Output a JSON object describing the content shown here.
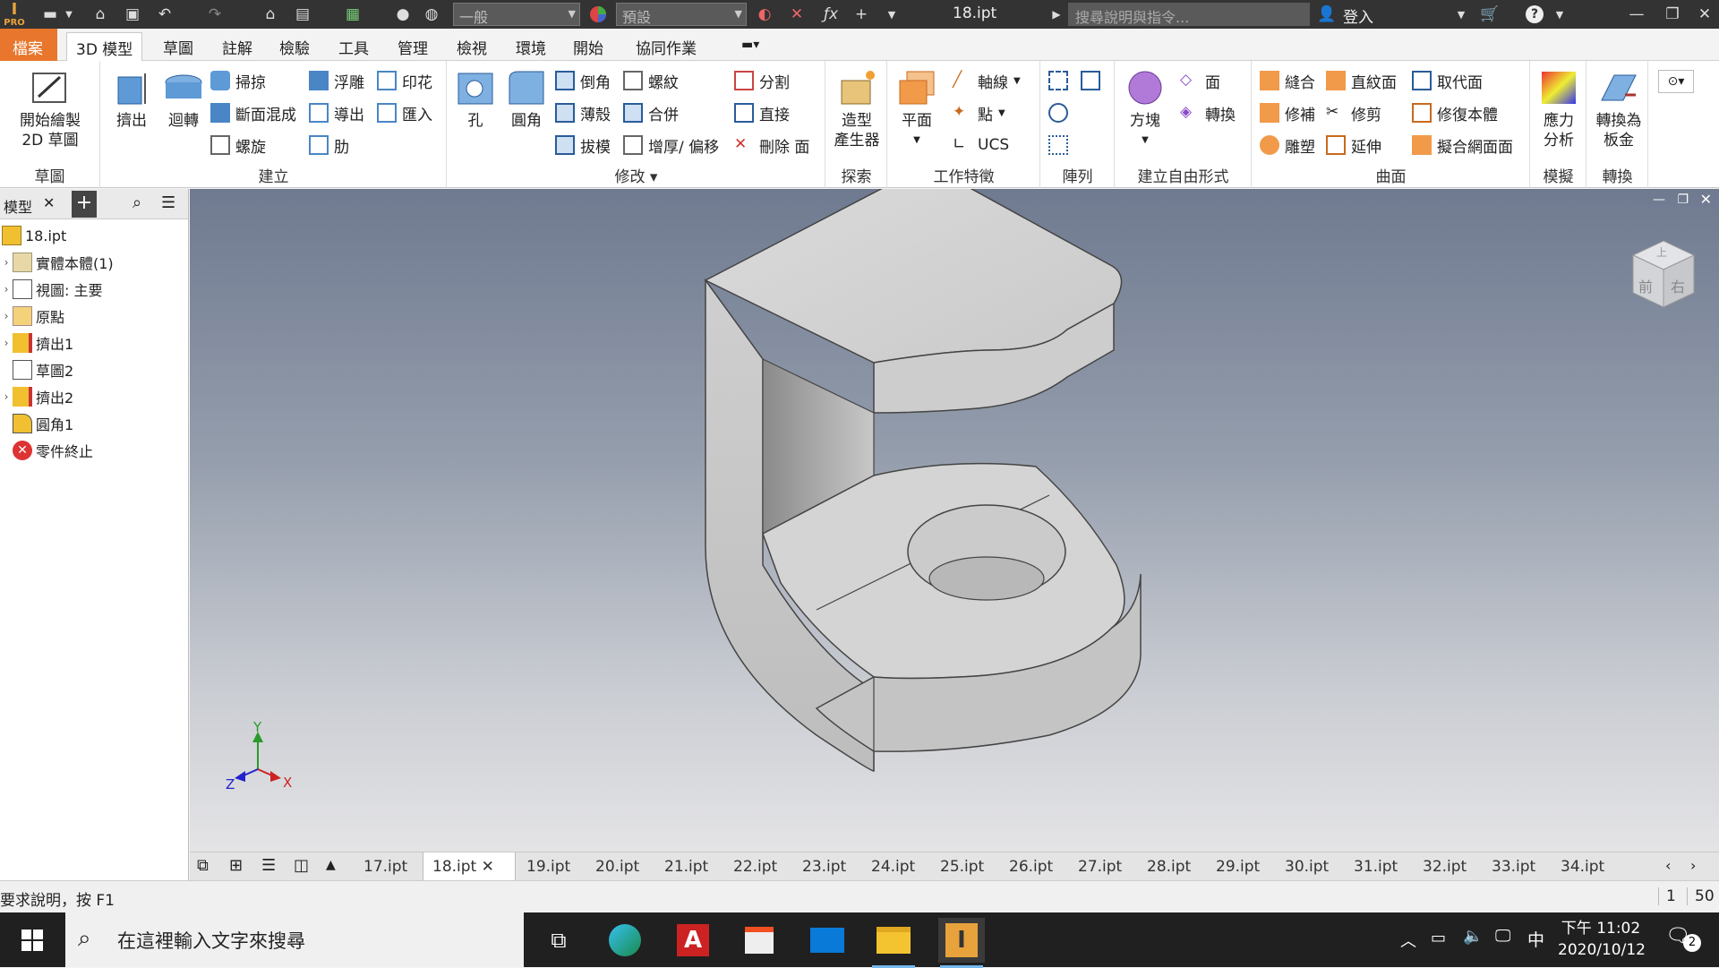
{
  "titlebar": {
    "app_logo": "PRO",
    "style_combo": "一般",
    "appearance_combo": "預設",
    "doc_title": "18.ipt",
    "search_placeholder": "搜尋說明與指令...",
    "sign_in": "登入",
    "icons": [
      "new-icon",
      "open-icon",
      "save-icon",
      "undo-icon",
      "redo-icon",
      "home-icon",
      "project-icon",
      "select-icon",
      "color-icon",
      "clear-appearance-icon",
      "fx-icon",
      "plus-icon",
      "cart-icon",
      "help-icon",
      "minimize-icon",
      "restore-icon",
      "close-icon"
    ]
  },
  "ribbon_tabs": [
    "檔案",
    "3D 模型",
    "草圖",
    "註解",
    "檢驗",
    "工具",
    "管理",
    "檢視",
    "環境",
    "開始",
    "協同作業"
  ],
  "ribbon": {
    "sketch": {
      "title": "草圖",
      "start_sketch": "開始繪製\n2D 草圖"
    },
    "create": {
      "title": "建立",
      "extrude": "擠出",
      "revolve": "迴轉",
      "sweep": "掃掠",
      "loft": "斷面混成",
      "coil": "螺旋",
      "emboss": "浮雕",
      "derive": "導出",
      "rib": "肋",
      "decal": "印花",
      "import": "匯入"
    },
    "modify": {
      "title": "修改",
      "hole": "孔",
      "fillet": "圓角",
      "chamfer": "倒角",
      "shell": "薄殼",
      "draft": "拔模",
      "thread": "螺紋",
      "combine": "合併",
      "thicken": "增厚/ 偏移",
      "split": "分割",
      "direct": "直接",
      "delete_face": "刪除 面"
    },
    "explore": {
      "title": "探索",
      "shape_generator": "造型\n產生器"
    },
    "work_features": {
      "title": "工作特徵",
      "plane": "平面",
      "axis": "軸線",
      "point": "點",
      "ucs": "UCS"
    },
    "pattern": {
      "title": "陣列"
    },
    "freeform": {
      "title": "建立自由形式",
      "box": "方塊",
      "face": "面",
      "convert": "轉換"
    },
    "surface": {
      "title": "曲面",
      "stitch": "縫合",
      "patch": "修補",
      "sculpt": "雕塑",
      "ruled": "直紋面",
      "trim": "修剪",
      "extend": "延伸",
      "replace_face": "取代面",
      "repair_bodies": "修復本體",
      "fit_mesh_face": "擬合網面面"
    },
    "simulation": {
      "title": "模擬",
      "stress": "應力\n分析"
    },
    "convert": {
      "title": "轉換",
      "to_sheet_metal": "轉換為\n板金"
    }
  },
  "browser": {
    "tab_label": "模型",
    "items": [
      {
        "label": "18.ipt",
        "icon": "part-icon"
      },
      {
        "label": "實體本體(1)",
        "icon": "solid-bodies-icon"
      },
      {
        "label": "視圖: 主要",
        "icon": "view-icon"
      },
      {
        "label": "原點",
        "icon": "origin-folder-icon"
      },
      {
        "label": "擠出1",
        "icon": "extrude-icon"
      },
      {
        "label": "草圖2",
        "icon": "sketch-icon"
      },
      {
        "label": "擠出2",
        "icon": "extrude-icon"
      },
      {
        "label": "圓角1",
        "icon": "fillet-icon"
      },
      {
        "label": "零件終止",
        "icon": "end-of-part-icon"
      }
    ]
  },
  "viewcube": {
    "front": "前",
    "right": "右",
    "top": "上"
  },
  "axes": {
    "x": "X",
    "y": "Y",
    "z": "Z"
  },
  "doc_tabs": [
    "17.ipt",
    "18.ipt",
    "19.ipt",
    "20.ipt",
    "21.ipt",
    "22.ipt",
    "23.ipt",
    "24.ipt",
    "25.ipt",
    "26.ipt",
    "27.ipt",
    "28.ipt",
    "29.ipt",
    "30.ipt",
    "31.ipt",
    "32.ipt",
    "33.ipt",
    "34.ipt"
  ],
  "active_doc": "18.ipt",
  "status": {
    "help_text": "要求說明，按 F1",
    "count_a": "1",
    "count_b": "50"
  },
  "taskbar": {
    "search_placeholder": "在這裡輸入文字來搜尋",
    "ime": "中",
    "time": "下午 11:02",
    "date": "2020/10/12",
    "notifications": "2"
  },
  "colors": {
    "accent": "#e8762c",
    "titlebar": "#333333",
    "taskbar": "#202020"
  }
}
